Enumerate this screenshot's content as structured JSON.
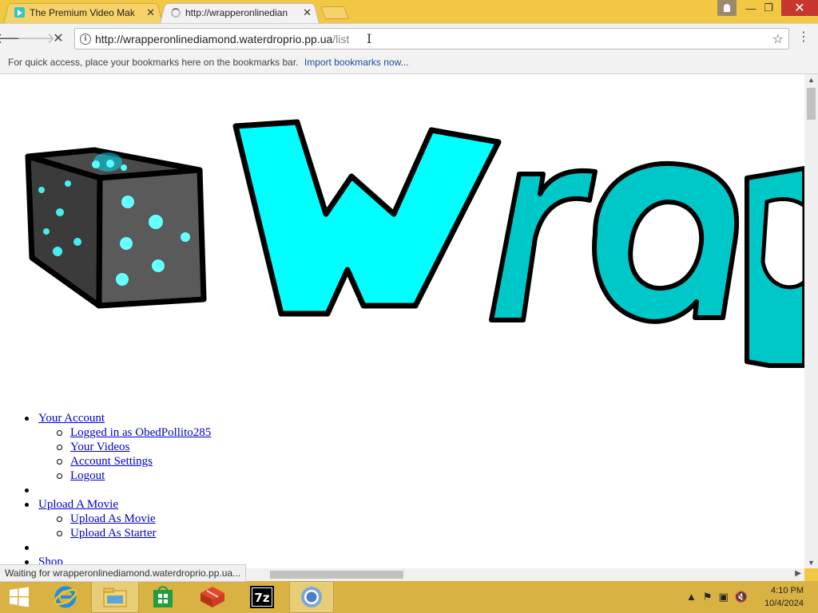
{
  "browser": {
    "tabs": [
      {
        "title": "The Premium Video Mak",
        "favicon": "video-favicon",
        "active": false
      },
      {
        "title": "http://wrapperonlinedian",
        "favicon": "loading-spinner",
        "active": true
      }
    ],
    "url": {
      "host": "http://wrapperonlinediamond.waterdroprio.pp.ua",
      "path": "/list"
    },
    "bookmarks_bar": {
      "message": "For quick access, place your bookmarks here on the bookmarks bar.",
      "import_link": "Import bookmarks now..."
    },
    "status_text": "Waiting for wrapperonlinediamond.waterdroprio.pp.ua..."
  },
  "page": {
    "logo_text": "Wrap",
    "nav": [
      {
        "label": "Your Account",
        "children": [
          "Logged in as ObedPollito285",
          "Your Videos",
          "Account Settings",
          "Logout"
        ]
      },
      {
        "label": "Upload A Movie",
        "children": [
          "Upload As Movie",
          "Upload As Starter"
        ]
      },
      {
        "label": "Shop",
        "children": []
      }
    ]
  },
  "taskbar": {
    "apps": [
      "start-button",
      "internet-explorer",
      "file-explorer",
      "store",
      "red-app",
      "7zip",
      "chrome"
    ],
    "active_app": "chrome",
    "clock_time": "4:10 PM",
    "clock_date": "10/4/2024"
  },
  "colors": {
    "chrome_frame": "#f2c744",
    "taskbar": "#d8b243",
    "logo_cyan": "#00ffff",
    "logo_teal": "#00c8c8",
    "link": "#0000cc"
  }
}
